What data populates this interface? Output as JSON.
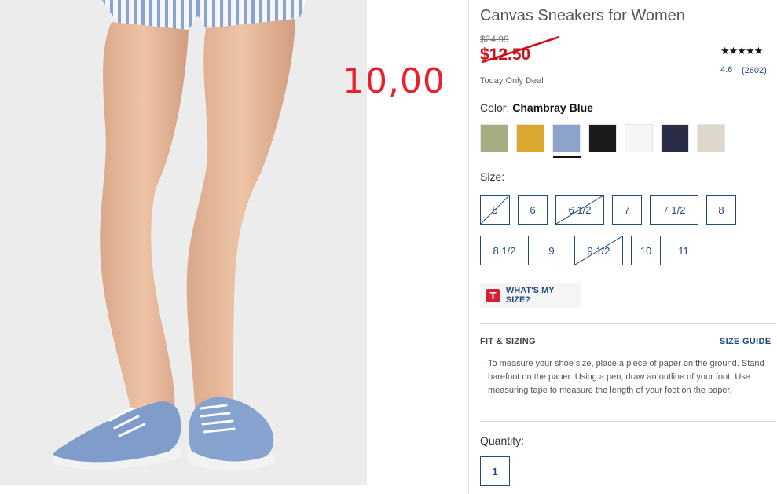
{
  "product": {
    "title": "Canvas Sneakers for Women",
    "original_price": "$24.99",
    "sale_price": "$12.50",
    "deal_label": "Today Only Deal",
    "overlay_price": "10,00",
    "rating": {
      "stars_glyph": "★★★★★",
      "value": "4.6",
      "count": "(2602)",
      "out_of": 5
    }
  },
  "color": {
    "label": "Color:",
    "selected_name": "Chambray Blue",
    "swatches": [
      {
        "name": "sage-green",
        "hex": "#a6ad82",
        "selected": false
      },
      {
        "name": "mustard",
        "hex": "#d9a82c",
        "selected": false
      },
      {
        "name": "chambray-blue",
        "hex": "#8ea3c9",
        "selected": true
      },
      {
        "name": "black",
        "hex": "#1b1b1b",
        "selected": false
      },
      {
        "name": "white",
        "hex": "#f6f6f6",
        "selected": false
      },
      {
        "name": "navy",
        "hex": "#2a2d45",
        "selected": false
      },
      {
        "name": "stone",
        "hex": "#ddd7cc",
        "selected": false
      }
    ]
  },
  "size": {
    "label": "Size:",
    "options": [
      {
        "label": "5",
        "available": false
      },
      {
        "label": "6",
        "available": true
      },
      {
        "label": "6 1/2",
        "available": false
      },
      {
        "label": "7",
        "available": true
      },
      {
        "label": "7 1/2",
        "available": true
      },
      {
        "label": "8",
        "available": true
      },
      {
        "label": "8 1/2",
        "available": true
      },
      {
        "label": "9",
        "available": true
      },
      {
        "label": "9 1/2",
        "available": false
      },
      {
        "label": "10",
        "available": true
      },
      {
        "label": "11",
        "available": true
      }
    ]
  },
  "whats_my_size": {
    "badge": "T",
    "label": "WHAT'S MY SIZE?"
  },
  "fit": {
    "title": "FIT & SIZING",
    "guide_link": "SIZE GUIDE",
    "bullet": "·",
    "text": "To measure your shoe size, place a piece of paper on the ground. Stand barefoot on the paper. Using a pen, draw an outline of your foot. Use measuring tape to measure the length of your foot on the paper."
  },
  "quantity": {
    "label": "Quantity:",
    "value": "1"
  },
  "colors": {
    "accent_navy": "#1f4b7e",
    "sale_red": "#cc0f1a",
    "overlay_red": "#e8212e"
  }
}
